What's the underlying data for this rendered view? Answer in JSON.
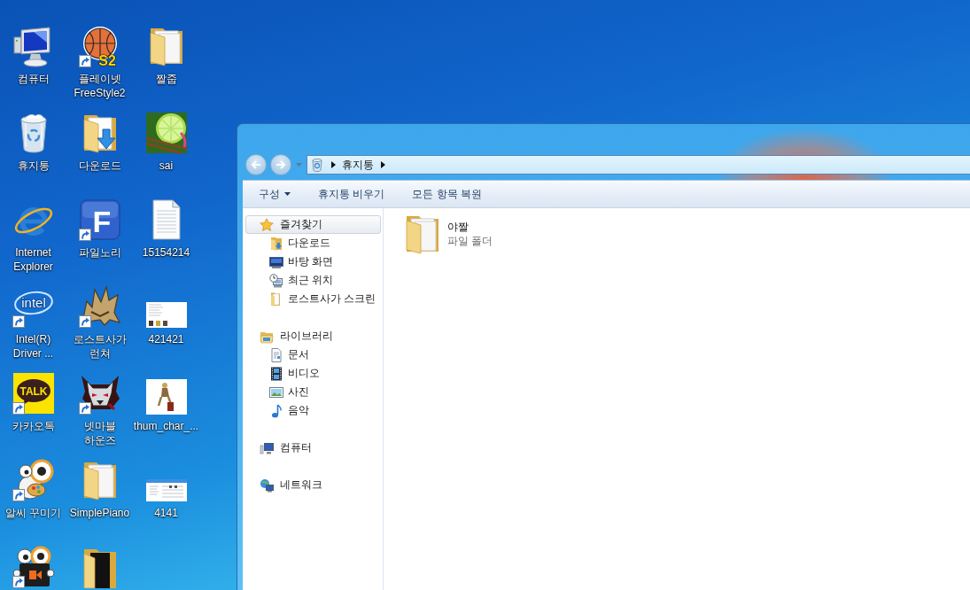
{
  "desktop_icons": [
    {
      "kind": "computer",
      "label": "컴퓨터",
      "shortcut": false
    },
    {
      "kind": "basketball",
      "label": "플레이넷 FreeStyle2",
      "logo_text": "S2",
      "shortcut": true
    },
    {
      "kind": "folder",
      "label": "짤줍",
      "shortcut": false
    },
    {
      "kind": "recycle-bin",
      "label": "휴지통",
      "shortcut": false
    },
    {
      "kind": "download-folder",
      "label": "다운로드",
      "shortcut": false
    },
    {
      "kind": "lime",
      "label": "sai",
      "shortcut": false
    },
    {
      "kind": "browser",
      "label": "Internet Explorer",
      "shortcut": false
    },
    {
      "kind": "letter-tile",
      "label": "파일노리",
      "logo_text": "F",
      "shortcut": true
    },
    {
      "kind": "text-file",
      "label": "15154214",
      "shortcut": false
    },
    {
      "kind": "swoosh",
      "label": "Intel(R) Driver ...",
      "logo_text": "intel",
      "shortcut": true
    },
    {
      "kind": "helmet",
      "label": "로스트사가 런쳐",
      "shortcut": true
    },
    {
      "kind": "thumbnail",
      "label": "421421",
      "shortcut": false
    },
    {
      "kind": "chat-tile",
      "label": "카카오톡",
      "logo_text": "TALK",
      "shortcut": true
    },
    {
      "kind": "wolf",
      "label": "넷마블 하운즈",
      "shortcut": true
    },
    {
      "kind": "photo",
      "label": "thum_char_...",
      "shortcut": false
    },
    {
      "kind": "mascot",
      "label": "알씨 꾸미기",
      "shortcut": true
    },
    {
      "kind": "folder",
      "label": "SimplePiano",
      "shortcut": false
    },
    {
      "kind": "screenshot",
      "label": "4141",
      "shortcut": false
    },
    {
      "kind": "mascot-video",
      "shortcut": true
    },
    {
      "kind": "dark-folder",
      "shortcut": false
    }
  ],
  "explorer": {
    "nav_buttons": [
      {
        "kind": "back",
        "disabled": true
      },
      {
        "kind": "forward",
        "disabled": true
      }
    ],
    "address_bar": {
      "breadcrumbs": [
        "휴지통"
      ]
    },
    "toolbar": [
      {
        "kind": "menu",
        "label": "구성"
      },
      {
        "kind": "button",
        "label": "휴지통 비우기"
      },
      {
        "kind": "button",
        "label": "모든 항목 복원"
      }
    ],
    "navigation_pane": [
      {
        "kind": "star",
        "label": "즐겨찾기",
        "selected": true,
        "children": [
          {
            "kind": "download-folder",
            "label": "다운로드",
            "selected": false
          },
          {
            "kind": "desktop",
            "label": "바탕 화면",
            "selected": false
          },
          {
            "kind": "recent",
            "label": "최근 위치",
            "selected": false
          },
          {
            "kind": "folder",
            "label": "로스트사가 스크린",
            "selected": false
          }
        ]
      },
      {
        "kind": "library",
        "label": "라이브러리",
        "selected": false,
        "children": [
          {
            "kind": "document",
            "label": "문서",
            "selected": false
          },
          {
            "kind": "video",
            "label": "비디오",
            "selected": false
          },
          {
            "kind": "picture",
            "label": "사진",
            "selected": false
          },
          {
            "kind": "music",
            "label": "음악",
            "selected": false
          }
        ]
      },
      {
        "kind": "computer",
        "label": "컴퓨터",
        "selected": false
      },
      {
        "kind": "network",
        "label": "네트워크",
        "selected": false
      }
    ],
    "items": [
      {
        "name": "야짤",
        "detail": "파일 폴더"
      }
    ]
  }
}
